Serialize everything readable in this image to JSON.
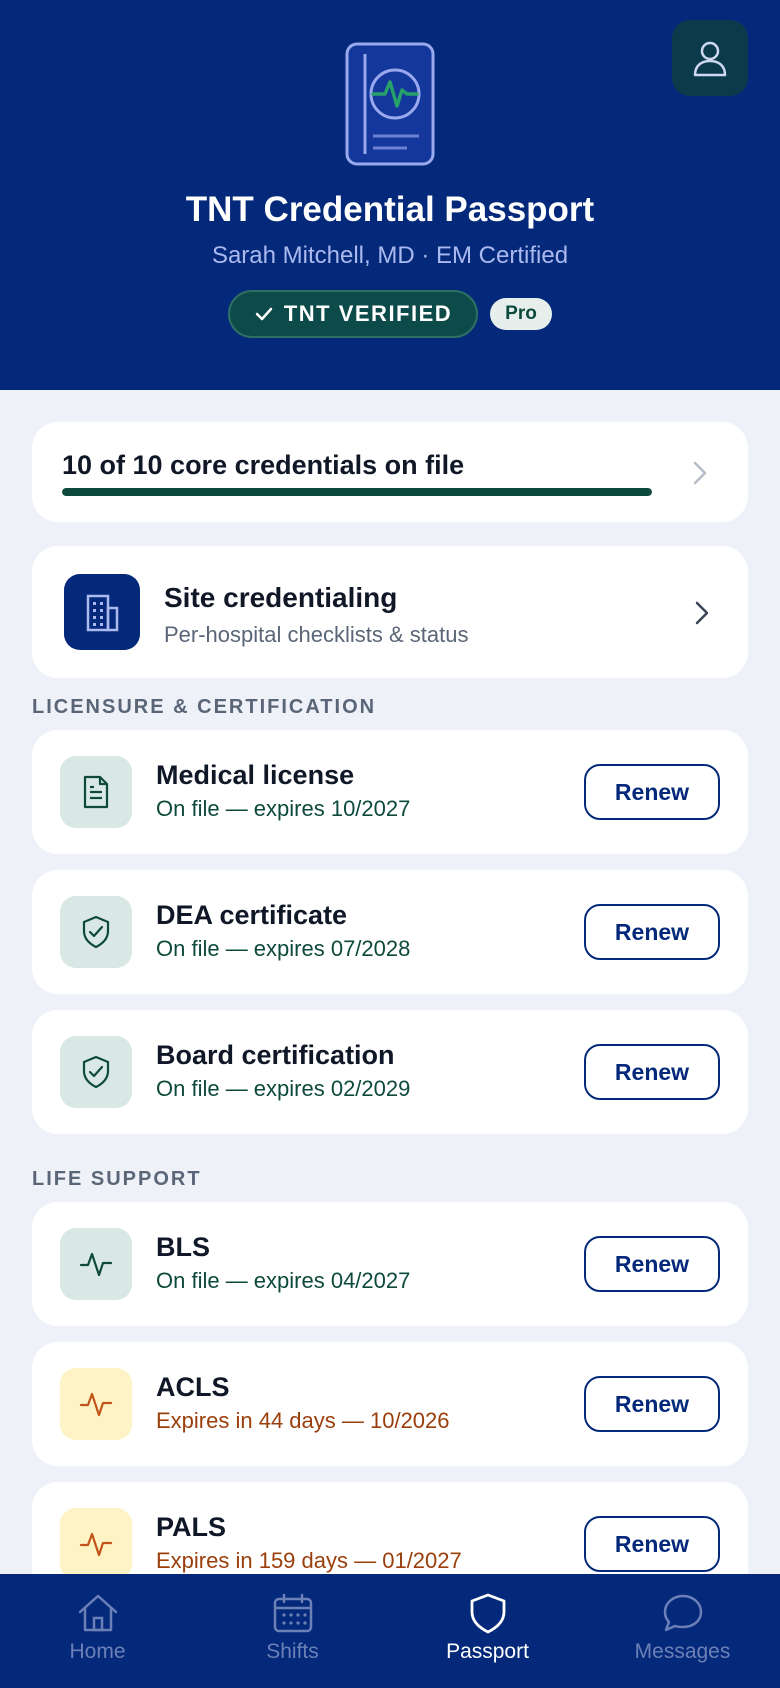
{
  "header": {
    "title": "TNT Credential Passport",
    "subtitle": "Sarah Mitchell, MD · EM Certified",
    "verified_badge": "TNT VERIFIED",
    "tier_badge": "Pro",
    "profile_icon": "user-icon",
    "passport_icon": "passport-heartbeat-icon"
  },
  "progress": {
    "text": "10 of 10 core credentials on file",
    "completed": 10,
    "total": 10
  },
  "site": {
    "title": "Site credentialing",
    "subtitle": "Per-hospital checklists & status",
    "icon": "building-icon"
  },
  "sections": {
    "licensure": "LICENSURE & CERTIFICATION",
    "life_support": "LIFE SUPPORT"
  },
  "licensure_items": [
    {
      "name": "Medical license",
      "status": "On file — expires 10/2027",
      "state": "ok",
      "icon": "document-icon",
      "action": "Renew"
    },
    {
      "name": "DEA certificate",
      "status": "On file — expires 07/2028",
      "state": "ok",
      "icon": "shield-check-icon",
      "action": "Renew"
    },
    {
      "name": "Board certification",
      "status": "On file — expires 02/2029",
      "state": "ok",
      "icon": "shield-check-icon",
      "action": "Renew"
    }
  ],
  "life_support_items": [
    {
      "name": "BLS",
      "status": "On file — expires 04/2027",
      "state": "ok",
      "icon": "pulse-icon",
      "action": "Renew"
    },
    {
      "name": "ACLS",
      "status": "Expires in 44 days — 10/2026",
      "state": "warn",
      "icon": "pulse-icon",
      "action": "Renew"
    },
    {
      "name": "PALS",
      "status": "Expires in 159 days — 01/2027",
      "state": "warn",
      "icon": "pulse-icon",
      "action": "Renew"
    }
  ],
  "tabs": [
    {
      "label": "Home",
      "icon": "home-icon",
      "active": false
    },
    {
      "label": "Shifts",
      "icon": "calendar-icon",
      "active": false
    },
    {
      "label": "Passport",
      "icon": "shield-icon",
      "active": true
    },
    {
      "label": "Messages",
      "icon": "chat-icon",
      "active": false
    }
  ],
  "colors": {
    "brand_navy": "#05297a",
    "success_green": "#0e4a3c",
    "warning_orange": "#9a3f0c",
    "background": "#eef2f8"
  }
}
